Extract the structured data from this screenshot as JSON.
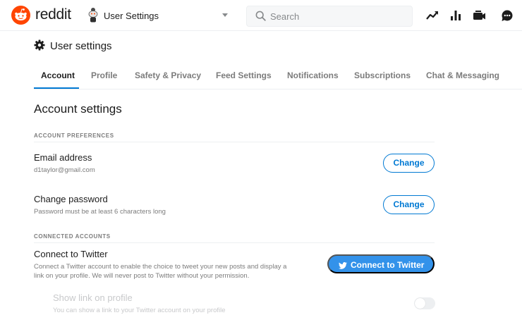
{
  "header": {
    "wordmark": "reddit",
    "community_label": "User Settings",
    "search_placeholder": "Search",
    "icons": [
      "popular-icon",
      "all-icon",
      "rpan-icon",
      "chat-icon"
    ]
  },
  "page": {
    "title": "User settings"
  },
  "tabs": [
    {
      "label": "Account",
      "active": true
    },
    {
      "label": "Profile",
      "active": false
    },
    {
      "label": "Safety & Privacy",
      "active": false
    },
    {
      "label": "Feed Settings",
      "active": false
    },
    {
      "label": "Notifications",
      "active": false
    },
    {
      "label": "Subscriptions",
      "active": false
    },
    {
      "label": "Chat & Messaging",
      "active": false
    }
  ],
  "account": {
    "section_title": "Account settings",
    "preferences_heading": "ACCOUNT PREFERENCES",
    "email": {
      "label": "Email address",
      "value": "d1taylor@gmail.com",
      "button": "Change"
    },
    "password": {
      "label": "Change password",
      "description": "Password must be at least 6 characters long",
      "button": "Change"
    },
    "connected_heading": "CONNECTED ACCOUNTS",
    "twitter": {
      "label": "Connect to Twitter",
      "description_line1": "Connect a Twitter account to enable the choice to tweet your new posts and display a",
      "description_line2": "link on your profile. We will never post to Twitter without your permission.",
      "button": "Connect to Twitter"
    },
    "show_link": {
      "label": "Show link on profile",
      "description": "You can show a link to your Twitter account on your profile",
      "enabled": false,
      "disabled": true
    }
  },
  "colors": {
    "brand": "#ff4500",
    "accent": "#0079d3",
    "twitter_button": "#3392ea"
  }
}
